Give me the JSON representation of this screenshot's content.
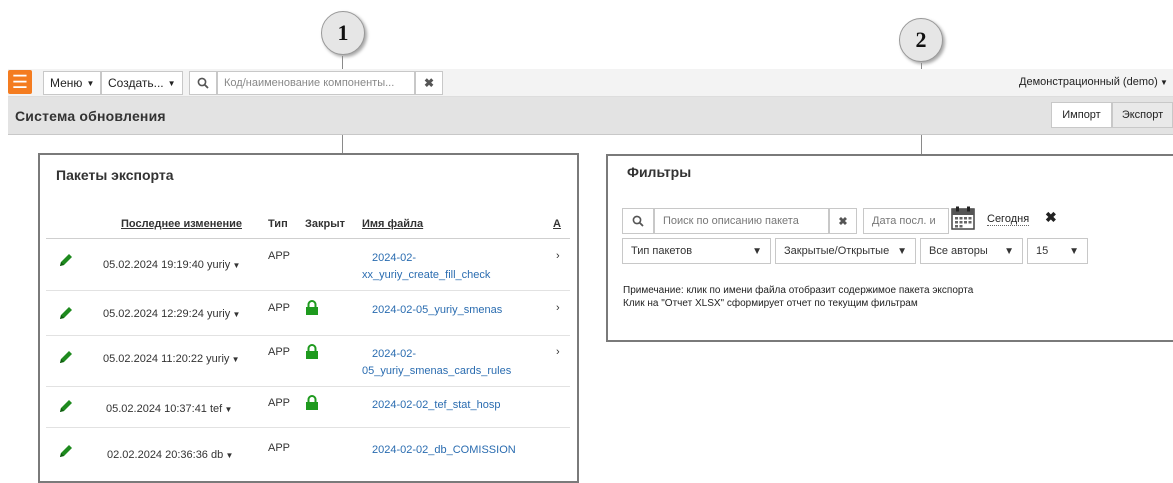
{
  "callouts": {
    "one": "1",
    "two": "2"
  },
  "topbar": {
    "menu_label": "Меню",
    "create_label": "Создать...",
    "search_placeholder": "Код/наименование компоненты...",
    "user_label": "Демонстрационный (demo)"
  },
  "header": {
    "title": "Система обновления",
    "import_label": "Импорт",
    "export_label": "Экспорт"
  },
  "export_panel": {
    "title": "Пакеты экспорта",
    "columns": {
      "modified": "Последнее изменение",
      "type": "Тип",
      "closed": "Закрыт",
      "filename": "Имя файла",
      "author": "А"
    },
    "rows": [
      {
        "modified": "05.02.2024 19:19:40 yuriy",
        "type": "APP",
        "file_line1": "2024-02-",
        "file_line2": "xx_yuriy_create_fill_check",
        "tail": "›"
      },
      {
        "modified": "05.02.2024 12:29:24 yuriy",
        "type": "APP",
        "file_line1": "2024-02-05_yuriy_smenas",
        "file_line2": "",
        "tail": "›"
      },
      {
        "modified": "05.02.2024 11:20:22 yuriy",
        "type": "APP",
        "file_line1": "2024-02-",
        "file_line2": "05_yuriy_smenas_cards_rules",
        "tail": "›"
      },
      {
        "modified": "05.02.2024 10:37:41 tef",
        "type": "APP",
        "file_line1": "2024-02-02_tef_stat_hosp",
        "file_line2": "",
        "tail": ""
      },
      {
        "modified": "02.02.2024 20:36:36 db",
        "type": "APP",
        "file_line1": "2024-02-02_db_COMISSION",
        "file_line2": "",
        "tail": ""
      }
    ]
  },
  "filters_panel": {
    "title": "Фильтры",
    "search_placeholder": "Поиск по описанию пакета",
    "date_placeholder": "Дата посл. и",
    "today_label": "Сегодня",
    "type_select": "Тип пакетов",
    "closed_select": "Закрытые/Открытые",
    "authors_select": "Все авторы",
    "page_size": "15",
    "note_line1": "Примечание: клик по имени файла отобразит содержимое пакета экспорта",
    "note_line2": "Клик на \"Отчет XLSX\" сформирует отчет по текущим фильтрам"
  },
  "colors": {
    "accent": "#f47c20",
    "link": "#2a6cb0",
    "lock": "#1e9a1e",
    "pencil": "#1e8a1e"
  },
  "icons": [
    "menu-icon",
    "search-icon",
    "clear-icon",
    "pencil-icon",
    "lock-icon",
    "calendar-icon",
    "close-icon",
    "chevron-down-icon"
  ]
}
